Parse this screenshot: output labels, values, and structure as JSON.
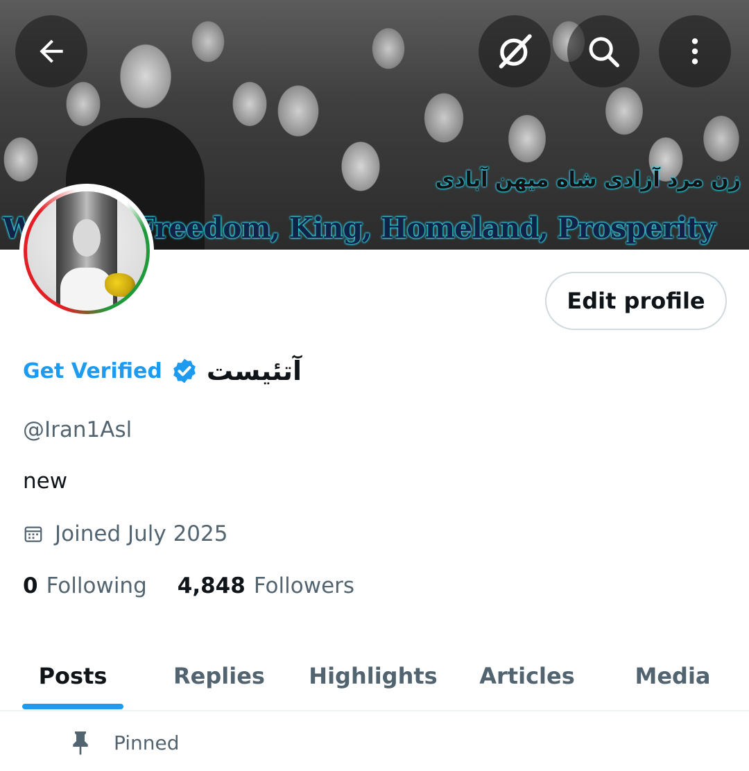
{
  "banner": {
    "persian_text": "زن مرد آزادی شاه میهن آبادی",
    "slogan_text": "Woman, Freedom, King, Homeland, Prosperity"
  },
  "header_icons": {
    "back": "back-arrow-icon",
    "grok": "grok-icon",
    "search": "search-icon",
    "more": "more-vertical-icon"
  },
  "profile": {
    "edit_button": "Edit profile",
    "get_verified": "Get Verified",
    "display_name": "آتئیست",
    "handle": "@Iran1Asl",
    "bio": "new",
    "joined": "Joined July 2025",
    "following_count": "0",
    "following_label": "Following",
    "followers_count": "4,848",
    "followers_label": "Followers"
  },
  "tabs": [
    {
      "label": "Posts",
      "active": true
    },
    {
      "label": "Replies",
      "active": false
    },
    {
      "label": "Highlights",
      "active": false
    },
    {
      "label": "Articles",
      "active": false
    },
    {
      "label": "Media",
      "active": false
    }
  ],
  "pinned_label": "Pinned",
  "colors": {
    "accent": "#1d9bf0",
    "text_primary": "#0f1419",
    "text_secondary": "#536471",
    "border": "#cfd9de"
  }
}
